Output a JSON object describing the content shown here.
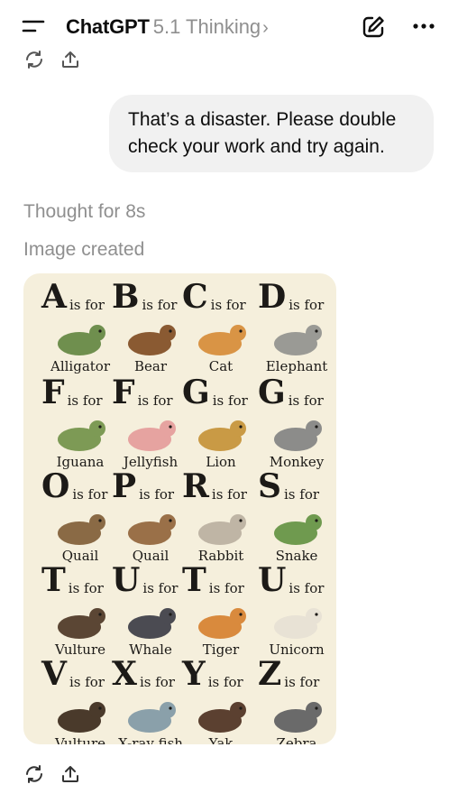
{
  "header": {
    "app_name": "ChatGPT",
    "model_label": "5.1 Thinking",
    "chevron": "›",
    "icons": [
      "menu-icon",
      "new-chat-icon",
      "more-icon"
    ]
  },
  "user_message": {
    "text": "That’s a disaster. Please double check your work and try again."
  },
  "assistant": {
    "thought_label": "Thought for 8s",
    "image_status": "Image created",
    "poster": {
      "is_for": "is for",
      "entries": [
        {
          "letter": "A",
          "animal": "Alligator"
        },
        {
          "letter": "B",
          "animal": "Bear"
        },
        {
          "letter": "C",
          "animal": "Cat"
        },
        {
          "letter": "D",
          "animal": "Elephant"
        },
        {
          "letter": "F",
          "animal": "Iguana"
        },
        {
          "letter": "F",
          "animal": "Jellyfish"
        },
        {
          "letter": "G",
          "animal": "Lion"
        },
        {
          "letter": "G",
          "animal": "Monkey"
        },
        {
          "letter": "O",
          "animal": "Quail"
        },
        {
          "letter": "P",
          "animal": "Quail"
        },
        {
          "letter": "R",
          "animal": "Rabbit"
        },
        {
          "letter": "S",
          "animal": "Snake"
        },
        {
          "letter": "T",
          "animal": "Vulture"
        },
        {
          "letter": "U",
          "animal": "Whale"
        },
        {
          "letter": "T",
          "animal": "Tiger"
        },
        {
          "letter": "U",
          "animal": "Unicorn"
        },
        {
          "letter": "V",
          "animal": "Vulture"
        },
        {
          "letter": "X",
          "animal": "X-ray fish"
        },
        {
          "letter": "Y",
          "animal": "Yak"
        },
        {
          "letter": "Z",
          "animal": "Zebra"
        }
      ]
    },
    "action_icons": [
      "regenerate-icon",
      "share-icon"
    ]
  },
  "colors": {
    "poster_background": "#f5efdc",
    "bubble_background": "#f1f1f1",
    "muted_text": "#8f8f8f"
  }
}
